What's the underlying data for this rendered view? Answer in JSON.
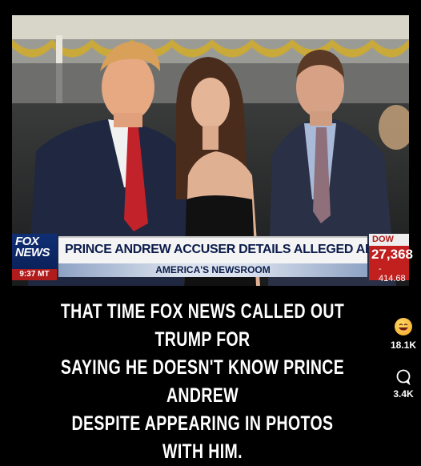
{
  "chyron": {
    "network_logo_line1": "FOX",
    "network_logo_line2": "NEWS",
    "time": "9:37 MT",
    "headline": "PRINCE ANDREW ACCUSER DETAILS ALLEGED ABUSE",
    "show_name": "AMERICA'S NEWSROOM",
    "ticker_label": "DOW WA",
    "ticker_value": "27,368",
    "ticker_change": "- 414.68"
  },
  "caption": {
    "line1": "THAT TIME FOX NEWS CALLED OUT TRUMP FOR",
    "line2": "SAYING HE DOESN'T KNOW PRINCE ANDREW",
    "line3": "DESPITE APPEARING IN PHOTOS WITH HIM."
  },
  "reactions": {
    "laugh_icon": "laughing-emoji-icon",
    "laugh_count": "18.1K",
    "comment_icon": "comment-bubble-icon",
    "comment_count": "3.4K"
  },
  "colors": {
    "fox_blue": "#0f2f74",
    "fox_red": "#c21f1f",
    "caption_text": "#ffffff",
    "background": "#000000"
  }
}
